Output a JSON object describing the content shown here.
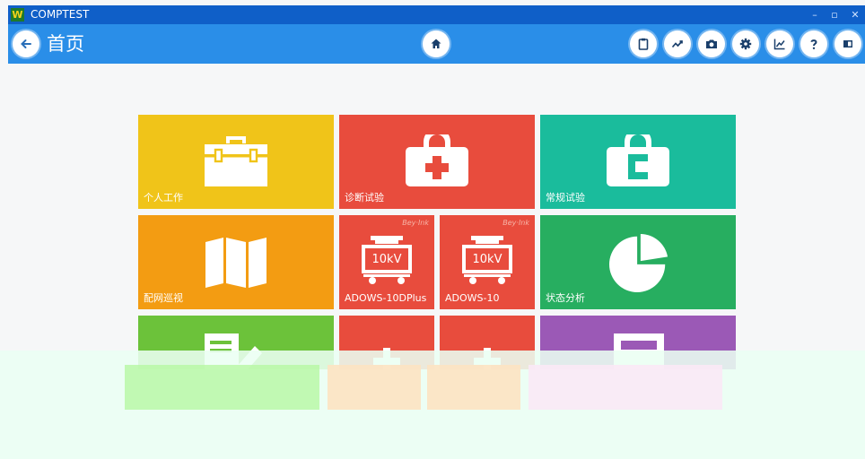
{
  "window": {
    "title": "COMPTEST",
    "logo_letter": "W"
  },
  "appbar": {
    "page_title": "首页",
    "icons": [
      "back-arrow-icon",
      "home-icon",
      "clipboard-icon",
      "trend-icon",
      "camera-icon",
      "settings-icon",
      "chart-icon",
      "help-icon",
      "exit-icon"
    ]
  },
  "tiles": {
    "personal_work": "个人工作",
    "diagnostic_test": "诊断试验",
    "routine_test": "常规试验",
    "network_patrol": "配网巡视",
    "adows_10dplus": "ADOWS-10DPlus",
    "adows_10": "ADOWS-10",
    "status_analysis": "状态分析",
    "voltage_badge": "10kV",
    "watermark": "Bey·Ink"
  },
  "colors": {
    "titlebar": "#0f5fc8",
    "appbar": "#2a8ee8",
    "yellow": "#f0c419",
    "red": "#e84c3d",
    "teal": "#1abc9c",
    "orange": "#f39c12",
    "green": "#27ae60",
    "lime": "#6cc23a",
    "purple": "#9b59b6"
  }
}
